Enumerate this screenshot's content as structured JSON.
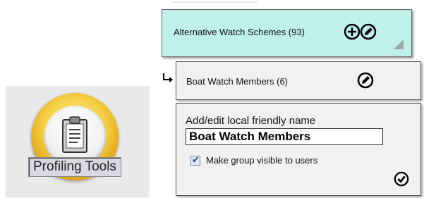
{
  "app_tile": {
    "label": "Profiling Tools",
    "icon": "clipboard-icon",
    "ring_color": "#e3a81a"
  },
  "scheme_card": {
    "label": "Alternative Watch Schemes (93)",
    "background": "#bff0ea",
    "icons": [
      "add-circle-icon",
      "edit-pencil-icon",
      "resize-grip-icon"
    ]
  },
  "group_card": {
    "label": "Boat Watch Members (6)",
    "icons": [
      "child-arrow-icon",
      "edit-pencil-icon"
    ]
  },
  "edit_panel": {
    "title": "Add/edit local friendly name",
    "name_value": "Boat Watch Members",
    "checkbox_label": "Make group visible to users",
    "checkbox_checked": true,
    "icons": [
      "confirm-check-icon"
    ]
  }
}
